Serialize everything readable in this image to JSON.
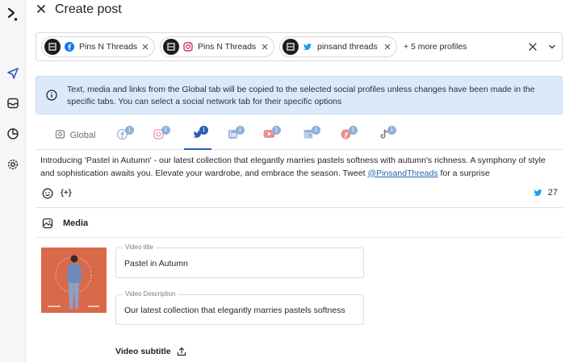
{
  "header": {
    "title": "Create post"
  },
  "rail": {
    "icons": [
      "logo-icon",
      "send-icon",
      "inbox-icon",
      "analytics-icon",
      "settings-icon"
    ]
  },
  "profiles": {
    "chips": [
      {
        "name": "Pins N Threads",
        "network": "facebook"
      },
      {
        "name": "Pins N Threads",
        "network": "instagram"
      },
      {
        "name": "pinsand threads",
        "network": "twitter"
      }
    ],
    "more_label": "+ 5 more profiles"
  },
  "banner": {
    "text": "Text, media and links from the Global tab will be copied to the selected social profiles unless changes have been made in the specific tabs. You can select a social network tab for their specific options"
  },
  "tabs": {
    "global_label": "Global",
    "networks": [
      {
        "name": "facebook",
        "badge": "1"
      },
      {
        "name": "instagram",
        "badge": "1"
      },
      {
        "name": "twitter",
        "badge": "1"
      },
      {
        "name": "linkedin",
        "badge": "1"
      },
      {
        "name": "youtube",
        "badge": "1"
      },
      {
        "name": "google-business",
        "badge": "1"
      },
      {
        "name": "pinterest",
        "badge": "1"
      },
      {
        "name": "tiktok",
        "badge": "1"
      }
    ]
  },
  "editor": {
    "text_before": "Introducing 'Pastel in Autumn' - our latest collection that elegantly marries pastels softness with autumn's richness. A symphony of style and sophistication awaits you. Elevate your wardrobe, and embrace the season. Tweet ",
    "mention": "@PinsandThreads",
    "text_after": " for a surprise",
    "vars_label": "{+}",
    "char_count": "27"
  },
  "media": {
    "heading": "Media",
    "video_title_label": "Video title",
    "video_title_value": "Pastel in Autumn",
    "video_desc_label": "Video Description",
    "video_desc_value": "Our latest collection that elegantly marries pastels softness",
    "subtitle_label": "Video subtitle"
  },
  "colors": {
    "accent": "#2a5fb8",
    "banner_bg": "#dbe9fa",
    "facebook": "#1877f2",
    "twitter": "#1d9bf0",
    "instagram": "#d6336c"
  }
}
